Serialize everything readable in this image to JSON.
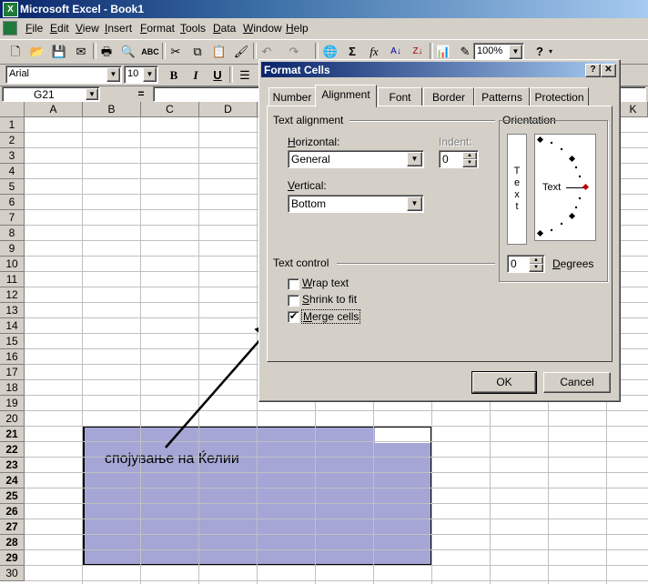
{
  "app": {
    "title": "Microsoft Excel - Book1",
    "icon": "excel-icon"
  },
  "menu": [
    "File",
    "Edit",
    "View",
    "Insert",
    "Format",
    "Tools",
    "Data",
    "Window",
    "Help"
  ],
  "toolbar": {
    "zoom": "100%",
    "font_name": "Arial",
    "font_size": "10"
  },
  "formula_bar": {
    "name_box": "G21",
    "equals": "=",
    "formula": ""
  },
  "sheet": {
    "columns": [
      "A",
      "B",
      "C",
      "D",
      "K"
    ],
    "rows": [
      "1",
      "2",
      "3",
      "4",
      "5",
      "6",
      "7",
      "8",
      "9",
      "10",
      "11",
      "12",
      "13",
      "14",
      "15",
      "16",
      "17",
      "18",
      "19",
      "20",
      "21",
      "22",
      "23",
      "24",
      "25",
      "26",
      "27",
      "28",
      "29",
      "30"
    ],
    "annotation": "спојување на Ќелии"
  },
  "dialog": {
    "title": "Format Cells",
    "tabs": [
      "Number",
      "Alignment",
      "Font",
      "Border",
      "Patterns",
      "Protection"
    ],
    "active_tab": "Alignment",
    "text_alignment": {
      "heading": "Text alignment",
      "horizontal_label": "Horizontal:",
      "horizontal_value": "General",
      "vertical_label": "Vertical:",
      "vertical_value": "Bottom",
      "indent_label": "Indent:",
      "indent_value": "0"
    },
    "orientation": {
      "heading": "Orientation",
      "vertical_text": "T e x t",
      "text": "Text",
      "degrees_value": "0",
      "degrees_label": "Degrees"
    },
    "text_control": {
      "heading": "Text control",
      "wrap_text": {
        "label": "Wrap text",
        "checked": false
      },
      "shrink_to_fit": {
        "label": "Shrink to fit",
        "checked": false
      },
      "merge_cells": {
        "label": "Merge cells",
        "checked": true
      }
    },
    "ok_label": "OK",
    "cancel_label": "Cancel",
    "help_label": "?",
    "close_label": "✕"
  },
  "colors": {
    "selection": "#a5a6d6",
    "title_bar": "#0a246a",
    "face": "#d4d0c8"
  }
}
